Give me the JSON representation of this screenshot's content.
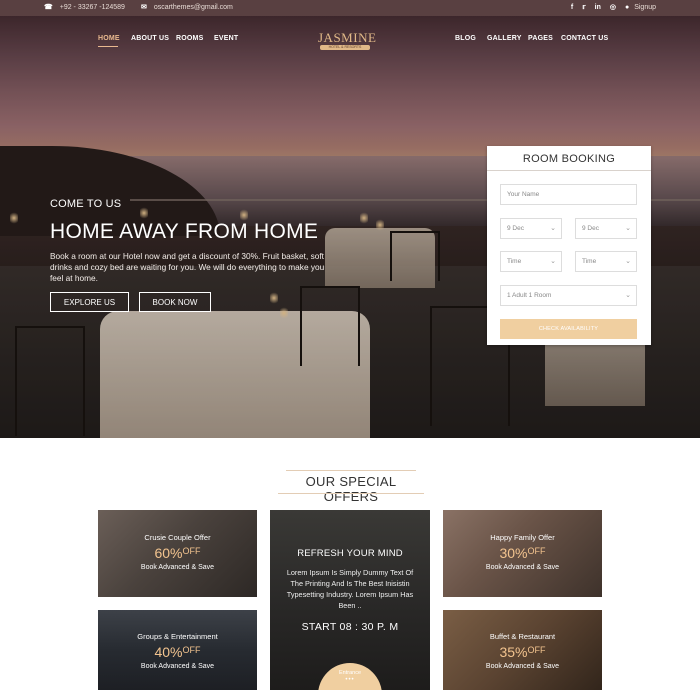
{
  "topbar": {
    "phone": "+92 - 33267 -124589",
    "email": "oscarthemes@gmail.com",
    "signup": "Signup",
    "social_icons": [
      "facebook-icon",
      "twitter-icon",
      "linkedin-icon",
      "tripadvisor-icon"
    ]
  },
  "nav": {
    "left": [
      "HOME",
      "ABOUT US",
      "ROOMS",
      "EVENT"
    ],
    "right": [
      "BLOG",
      "GALLERY",
      "PAGES",
      "CONTACT US"
    ],
    "active": "HOME"
  },
  "logo": {
    "name": "JASMINE",
    "tagline": "HOTEL & RESORTS"
  },
  "hero": {
    "kicker": "COME TO US",
    "headline": "HOME AWAY FROM HOME",
    "description": "Book a room at our Hotel now and get a discount of 30%. Fruit basket, soft drinks and cozy bed are waiting for you. We will do everything to make you feel at home.",
    "explore_label": "EXPLORE US",
    "book_label": "BOOK NOW"
  },
  "booking": {
    "title": "ROOM BOOKING",
    "name_placeholder": "Your Name",
    "checkin_date": "9 Dec",
    "checkout_date": "9 Dec",
    "checkin_time": "Time",
    "checkout_time": "Time",
    "guests": "1 Adult 1 Room",
    "check_label": "CHECK AVAILABILITY"
  },
  "offers": {
    "title": "OUR SPECIAL OFFERS",
    "cards": [
      {
        "title": "Crusie Couple Offer",
        "percent": "60%",
        "off": "OFF",
        "sub": "Book Advanced & Save"
      },
      {
        "title": "Happy Family Offer",
        "percent": "30%",
        "off": "OFF",
        "sub": "Book Advanced & Save"
      },
      {
        "title": "Groups & Entertainment",
        "percent": "40%",
        "off": "OFF",
        "sub": "Book Advanced & Save"
      },
      {
        "title": "Buffet & Restaurant",
        "percent": "35%",
        "off": "OFF",
        "sub": "Book Advanced & Save"
      }
    ],
    "center": {
      "title": "REFRESH YOUR MIND",
      "body": "Lorem Ipsum Is Simply Dummy Text Of The Printing And Is The Best Inisistin Typesetting Industry. Lorem Ipsum Has Been ..",
      "time": "START 08 : 30 P. M",
      "entrance": "Entrance",
      "entrance_dots": "•••"
    }
  },
  "colors": {
    "accent": "#e9b98f",
    "button": "#f0cfa0",
    "topbar": "#3c1e20"
  }
}
